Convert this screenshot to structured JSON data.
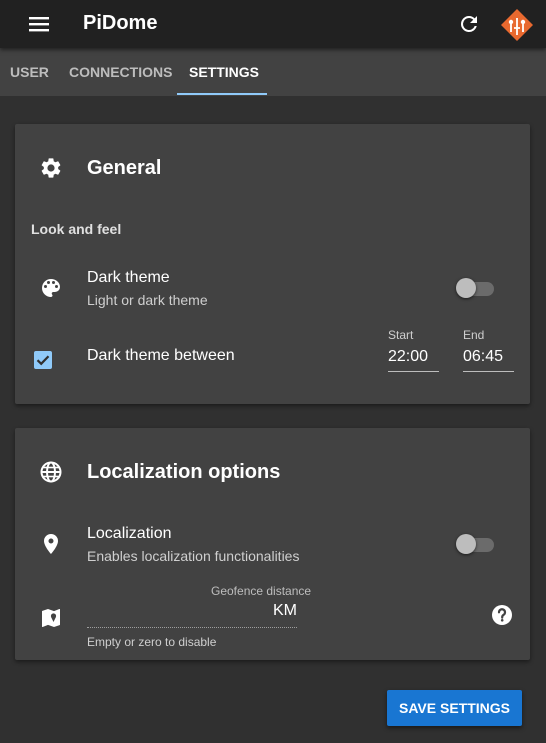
{
  "app": {
    "title": "PiDome"
  },
  "tabs": [
    {
      "label": "USER",
      "active": false
    },
    {
      "label": "CONNECTIONS",
      "active": false
    },
    {
      "label": "SETTINGS",
      "active": true
    }
  ],
  "colors": {
    "appbar": "#212121",
    "tabbar": "#424242",
    "background": "#303030",
    "card": "#424242",
    "accent": "#90caf9",
    "primary_button": "#1976d2",
    "logo": "#e8692f"
  },
  "general": {
    "icon": "gear-icon",
    "title": "General",
    "subheader": "Look and feel",
    "dark_theme": {
      "icon": "palette-icon",
      "title": "Dark theme",
      "subtitle": "Light or dark theme",
      "enabled": false
    },
    "dark_theme_between": {
      "label": "Dark theme between",
      "checked": true,
      "start_label": "Start",
      "start_value": "22:00",
      "end_label": "End",
      "end_value": "06:45"
    }
  },
  "localization": {
    "icon": "globe-icon",
    "title": "Localization options",
    "localization_item": {
      "icon": "location-pin-icon",
      "title": "Localization",
      "subtitle": "Enables localization functionalities",
      "enabled": false
    },
    "geofence": {
      "icon": "map-icon",
      "label": "Geofence distance",
      "value": "",
      "unit": "KM",
      "hint": "Empty or zero to disable"
    }
  },
  "actions": {
    "save_label": "SAVE SETTINGS"
  }
}
